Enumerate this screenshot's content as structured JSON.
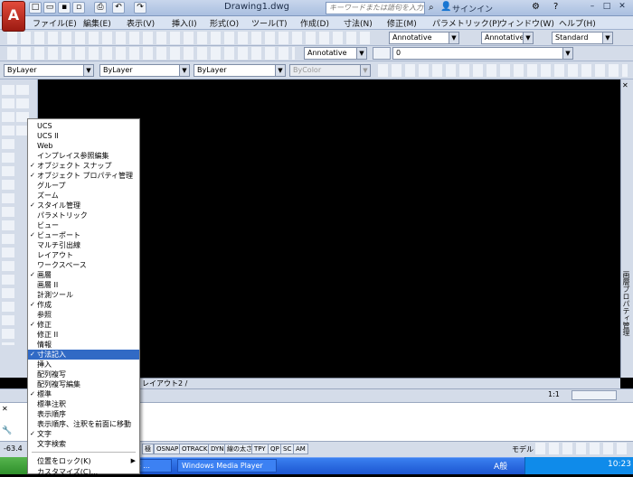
{
  "title": {
    "doc": "Drawing1.dwg",
    "search_placeholder": "キーワードまたは語句を入力",
    "signin": "サインイン"
  },
  "menus": [
    "ファイル(E)",
    "編集(E)",
    "表示(V)",
    "挿入(I)",
    "形式(O)",
    "ツール(T)",
    "作成(D)",
    "寸法(N)",
    "修正(M)",
    "パラメトリック(P)",
    "ウィンドウ(W)",
    "ヘルプ(H)"
  ],
  "toolbars": {
    "annotative1": "Annotative",
    "annotative2": "Annotative",
    "standard": "Standard",
    "annotative3": "Annotative",
    "layer_value": "0",
    "bylayer1": "ByLayer",
    "bylayer2": "ByLayer",
    "bylayer3": "ByLayer",
    "bycolor": "ByColor"
  },
  "context_menu": {
    "items": [
      {
        "label": "UCS",
        "checked": false
      },
      {
        "label": "UCS II",
        "checked": false
      },
      {
        "label": "Web",
        "checked": false
      },
      {
        "label": "インプレイス参照編集",
        "checked": false
      },
      {
        "label": "オブジェクト スナップ",
        "checked": true
      },
      {
        "label": "オブジェクト プロパティ管理",
        "checked": true
      },
      {
        "label": "グループ",
        "checked": false
      },
      {
        "label": "ズーム",
        "checked": false
      },
      {
        "label": "スタイル管理",
        "checked": true
      },
      {
        "label": "パラメトリック",
        "checked": false
      },
      {
        "label": "ビュー",
        "checked": false
      },
      {
        "label": "ビューポート",
        "checked": true
      },
      {
        "label": "マルチ引出線",
        "checked": false
      },
      {
        "label": "レイアウト",
        "checked": false
      },
      {
        "label": "ワークスペース",
        "checked": false
      },
      {
        "label": "画層",
        "checked": true
      },
      {
        "label": "画層 II",
        "checked": false
      },
      {
        "label": "計測ツール",
        "checked": false
      },
      {
        "label": "作成",
        "checked": true
      },
      {
        "label": "参照",
        "checked": false
      },
      {
        "label": "修正",
        "checked": true
      },
      {
        "label": "修正 II",
        "checked": false
      },
      {
        "label": "情報",
        "checked": false
      },
      {
        "label": "寸法記入",
        "checked": true
      },
      {
        "label": "挿入",
        "checked": false
      },
      {
        "label": "配列複写",
        "checked": false
      },
      {
        "label": "配列複写編集",
        "checked": false
      },
      {
        "label": "標準",
        "checked": true
      },
      {
        "label": "標準注釈",
        "checked": false
      },
      {
        "label": "表示順序",
        "checked": false
      },
      {
        "label": "表示順序、注釈を前面に移動",
        "checked": false
      },
      {
        "label": "文字",
        "checked": true
      },
      {
        "label": "文字検索",
        "checked": false
      }
    ],
    "selected_label": "寸法記入",
    "lock_label": "位置をロック(K)",
    "customize_label": "カスタマイズ(C)..."
  },
  "tabs": {
    "layout2": "レイアウト2 /"
  },
  "annotation": {
    "scale": "1:1"
  },
  "status": {
    "coords": "-63.4",
    "buttons": [
      "極",
      "OSNAP",
      "OTRACK",
      "DYN",
      "線の太さ",
      "TPY",
      "QP",
      "SC",
      "AM"
    ],
    "model": "モデル"
  },
  "dock_label": "画層プロパティ管理",
  "taskbar": {
    "task1": "313 - ...",
    "task2": "Windows Media Player",
    "ime": "A般",
    "clock": "10:23"
  }
}
